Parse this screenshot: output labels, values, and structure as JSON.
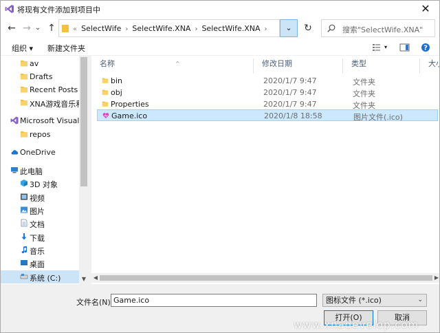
{
  "window": {
    "title": "将现有文件添加到项目中",
    "close_glyph": "✕"
  },
  "nav": {
    "back_glyph": "←",
    "forward_glyph": "→",
    "history_glyph": "⌄",
    "up_glyph": "↑",
    "breadcrumb_overflow": "«",
    "breadcrumbs": [
      "SelectWife",
      "SelectWife.XNA",
      "SelectWife.XNA"
    ],
    "crumb_sep": "›",
    "dropdown_glyph": "⌄",
    "refresh_glyph": "↻",
    "search_placeholder": "搜索\"SelectWife.XNA\""
  },
  "toolbar": {
    "organize": "组织 ▾",
    "new_folder": "新建文件夹"
  },
  "sidebar": {
    "items": [
      {
        "label": "av",
        "icon": "folder-icon"
      },
      {
        "label": "Drafts",
        "icon": "folder-icon"
      },
      {
        "label": "Recent Posts",
        "icon": "folder-icon"
      },
      {
        "label": "XNA游戏音乐和",
        "icon": "folder-icon"
      },
      {
        "label": "Microsoft Visual",
        "icon": "visual-studio-icon"
      },
      {
        "label": "repos",
        "icon": "folder-icon"
      },
      {
        "label": "OneDrive",
        "icon": "cloud-icon"
      },
      {
        "label": "此电脑",
        "icon": "computer-icon"
      },
      {
        "label": "3D 对象",
        "icon": "3d-objects-icon"
      },
      {
        "label": "视频",
        "icon": "video-icon"
      },
      {
        "label": "图片",
        "icon": "pictures-icon"
      },
      {
        "label": "文档",
        "icon": "documents-icon"
      },
      {
        "label": "下载",
        "icon": "download-icon"
      },
      {
        "label": "音乐",
        "icon": "music-icon"
      },
      {
        "label": "桌面",
        "icon": "desktop-icon"
      },
      {
        "label": "系统 (C:)",
        "icon": "drive-icon"
      }
    ]
  },
  "columns": {
    "name": "名称",
    "modified": "修改日期",
    "type": "类型",
    "size": "大小"
  },
  "files": [
    {
      "name": "bin",
      "modified": "2020/1/7 9:47",
      "type": "文件夹",
      "icon": "folder-icon"
    },
    {
      "name": "obj",
      "modified": "2020/1/7 9:47",
      "type": "文件夹",
      "icon": "folder-icon"
    },
    {
      "name": "Properties",
      "modified": "2020/1/7 9:47",
      "type": "文件夹",
      "icon": "folder-icon"
    },
    {
      "name": "Game.ico",
      "modified": "2020/1/8 18:58",
      "type": "图片文件(.ico)",
      "icon": "heart-ico-icon"
    }
  ],
  "footer": {
    "filename_label": "文件名(N):",
    "filename_value": "Game.ico",
    "filetype_value": "图标文件 (*.ico)",
    "open_label": "打开(O)",
    "cancel_label": "取消"
  },
  "watermark": "www.xnadevelop.com",
  "colors": {
    "selection": "#cce8ff",
    "folder": "#f3c13a",
    "vs_purple": "#865fc5",
    "accent": "#0078d7"
  }
}
